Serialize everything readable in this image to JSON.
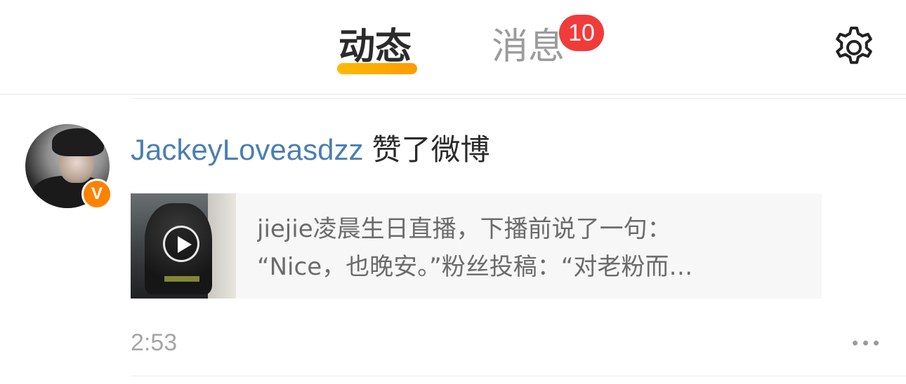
{
  "header": {
    "tabs": [
      {
        "label": "动态",
        "active": true
      },
      {
        "label": "消息",
        "active": false
      }
    ],
    "messages_badge": "10",
    "settings_icon": "gear-icon",
    "accent_color": "#ff9a00",
    "badge_color": "#f03b3b"
  },
  "feed": {
    "items": [
      {
        "username": "JackeyLoveasdzz",
        "action": "赞了微博",
        "verified_icon": "verified-v-icon",
        "card": {
          "line1": "jiejie凌晨生日直播，下播前说了一句：",
          "line2": "“Nice，也晚安。”粉丝投稿：“对老粉而…",
          "media_icon": "play-icon"
        },
        "time": "2:53",
        "more_icon": "more-dots-icon"
      }
    ]
  },
  "colors": {
    "username": "#4a7fb0",
    "verified_badge": "#ff8200"
  }
}
